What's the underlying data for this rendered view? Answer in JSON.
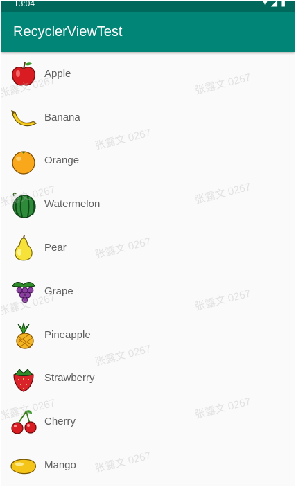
{
  "status_bar": {
    "time": "13:04",
    "icons": "▾ ◢ ▮"
  },
  "app_bar": {
    "title": "RecyclerViewTest",
    "color": "#008577"
  },
  "fruits": [
    {
      "name": "Apple",
      "icon": "apple-icon"
    },
    {
      "name": "Banana",
      "icon": "banana-icon"
    },
    {
      "name": "Orange",
      "icon": "orange-icon"
    },
    {
      "name": "Watermelon",
      "icon": "watermelon-icon"
    },
    {
      "name": "Pear",
      "icon": "pear-icon"
    },
    {
      "name": "Grape",
      "icon": "grape-icon"
    },
    {
      "name": "Pineapple",
      "icon": "pineapple-icon"
    },
    {
      "name": "Strawberry",
      "icon": "strawberry-icon"
    },
    {
      "name": "Cherry",
      "icon": "cherry-icon"
    },
    {
      "name": "Mango",
      "icon": "mango-icon"
    }
  ],
  "watermark": {
    "text": "张露文 0267"
  }
}
